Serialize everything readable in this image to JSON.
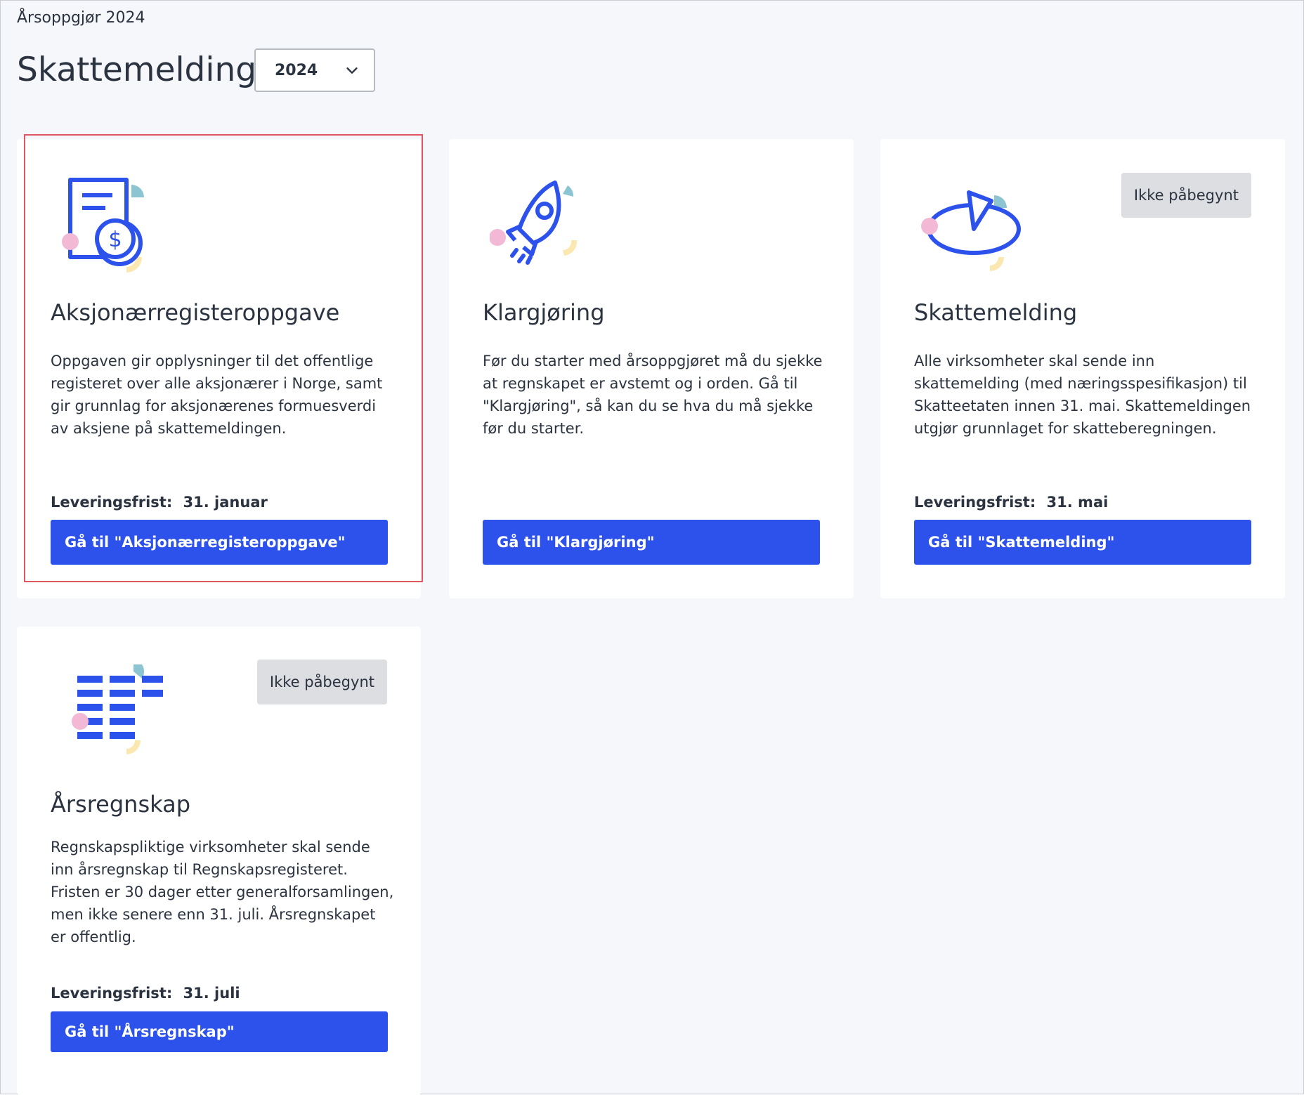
{
  "breadcrumb": "Årsoppgjør 2024",
  "title": "Skattemelding",
  "year_select": {
    "value": "2024"
  },
  "cards": [
    {
      "title": "Aksjonærregisteroppgave",
      "description": "Oppgaven gir opplysninger til det offentlige registeret over alle aksjonærer i Norge, samt gir grunnlag for aksjonærenes formuesverdi av aksjene på skattemeldingen.",
      "deadline_label": "Leveringsfrist:",
      "deadline_value": "31. januar",
      "button_label": "Gå til \"Aksjonærregisteroppgave\"",
      "icon": "document-coin-icon"
    },
    {
      "title": "Klargjøring",
      "description": "Før du starter med årsoppgjøret må du sjekke at regnskapet er avstemt og i orden. Gå til \"Klargjøring\", så kan du se hva du må sjekke før du starter.",
      "button_label": "Gå til \"Klargjøring\"",
      "icon": "rocket-icon"
    },
    {
      "title": "Skattemelding",
      "status": "Ikke påbegynt",
      "description": "Alle virksomheter skal sende inn skattemelding (med næringsspesifikasjon) til Skatteetaten innen 31. mai. Skattemeldingen utgjør grunnlaget for skatteberegningen.",
      "deadline_label": "Leveringsfrist:",
      "deadline_value": "31. mai",
      "button_label": "Gå til \"Skattemelding\"",
      "icon": "pie-chart-icon"
    },
    {
      "title": "Årsregnskap",
      "status": "Ikke påbegynt",
      "description": "Regnskapspliktige virksomheter skal sende inn årsregnskap til Regnskapsregisteret. Fristen er 30 dager etter generalforsamlingen, men ikke senere enn 31. juli. Årsregnskapet er offentlig.",
      "deadline_label": "Leveringsfrist:",
      "deadline_value": "31. juli",
      "button_label": "Gå til \"Årsregnskap\"",
      "icon": "table-grid-icon"
    }
  ],
  "colors": {
    "accent": "#2d52ec",
    "focus_outline": "#e0555f",
    "badge_bg": "#dcdee2",
    "decor_teal": "#8cc4d2",
    "decor_pink": "#f2b8d6",
    "decor_yellow": "#fbe7b0"
  }
}
